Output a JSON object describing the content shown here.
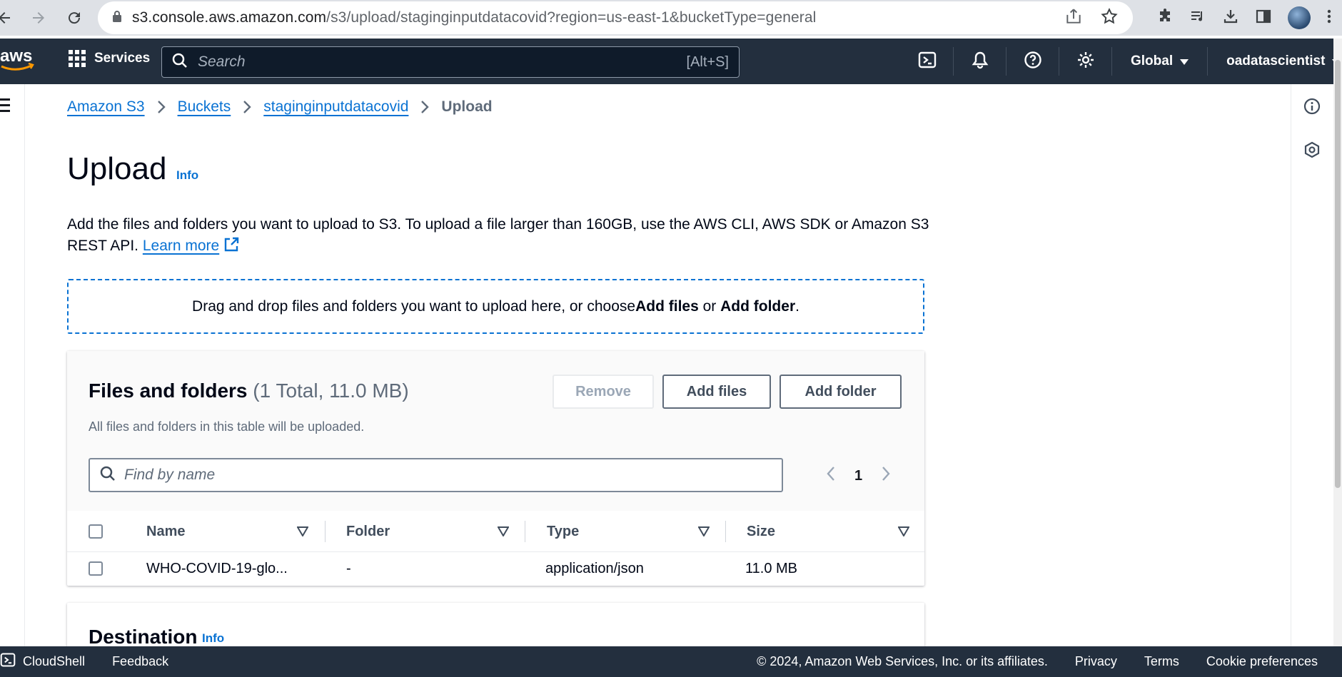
{
  "browser": {
    "url_host": "s3.console.aws.amazon.com",
    "url_path": "/s3/upload/staginginputdatacovid?region=us-east-1&bucketType=general"
  },
  "nav": {
    "services_label": "Services",
    "search_placeholder": "Search",
    "search_shortcut": "[Alt+S]",
    "region_label": "Global",
    "account_label": "oadatascientist"
  },
  "breadcrumb": {
    "items": [
      "Amazon S3",
      "Buckets",
      "staginginputdatacovid"
    ],
    "current": "Upload"
  },
  "page": {
    "title": "Upload",
    "info": "Info",
    "description": "Add the files and folders you want to upload to S3. To upload a file larger than 160GB, use the AWS CLI, AWS SDK or Amazon S3 REST API.",
    "learn_more": "Learn more"
  },
  "dropzone": {
    "text_before": "Drag and drop files and folders you want to upload here, or choose ",
    "add_files": "Add files",
    "or": " or ",
    "add_folder": "Add folder",
    "period": "."
  },
  "files": {
    "title": "Files and folders",
    "count": "(1 Total, 11.0 MB)",
    "subtitle": "All files and folders in this table will be uploaded.",
    "remove_label": "Remove",
    "add_files_label": "Add files",
    "add_folder_label": "Add folder",
    "filter_placeholder": "Find by name",
    "page": "1",
    "columns": [
      "Name",
      "Folder",
      "Type",
      "Size"
    ],
    "rows": [
      {
        "name": "WHO-COVID-19-glo...",
        "folder": "-",
        "type": "application/json",
        "size": "11.0 MB"
      }
    ]
  },
  "destination": {
    "title": "Destination",
    "info": "Info"
  },
  "footer": {
    "cloudshell": "CloudShell",
    "feedback": "Feedback",
    "copyright": "© 2024, Amazon Web Services, Inc. or its affiliates.",
    "privacy": "Privacy",
    "terms": "Terms",
    "cookie": "Cookie preferences"
  },
  "colors": {
    "aws_nav": "#232f3e",
    "link": "#0972d3",
    "aws_orange": "#ff9900"
  }
}
